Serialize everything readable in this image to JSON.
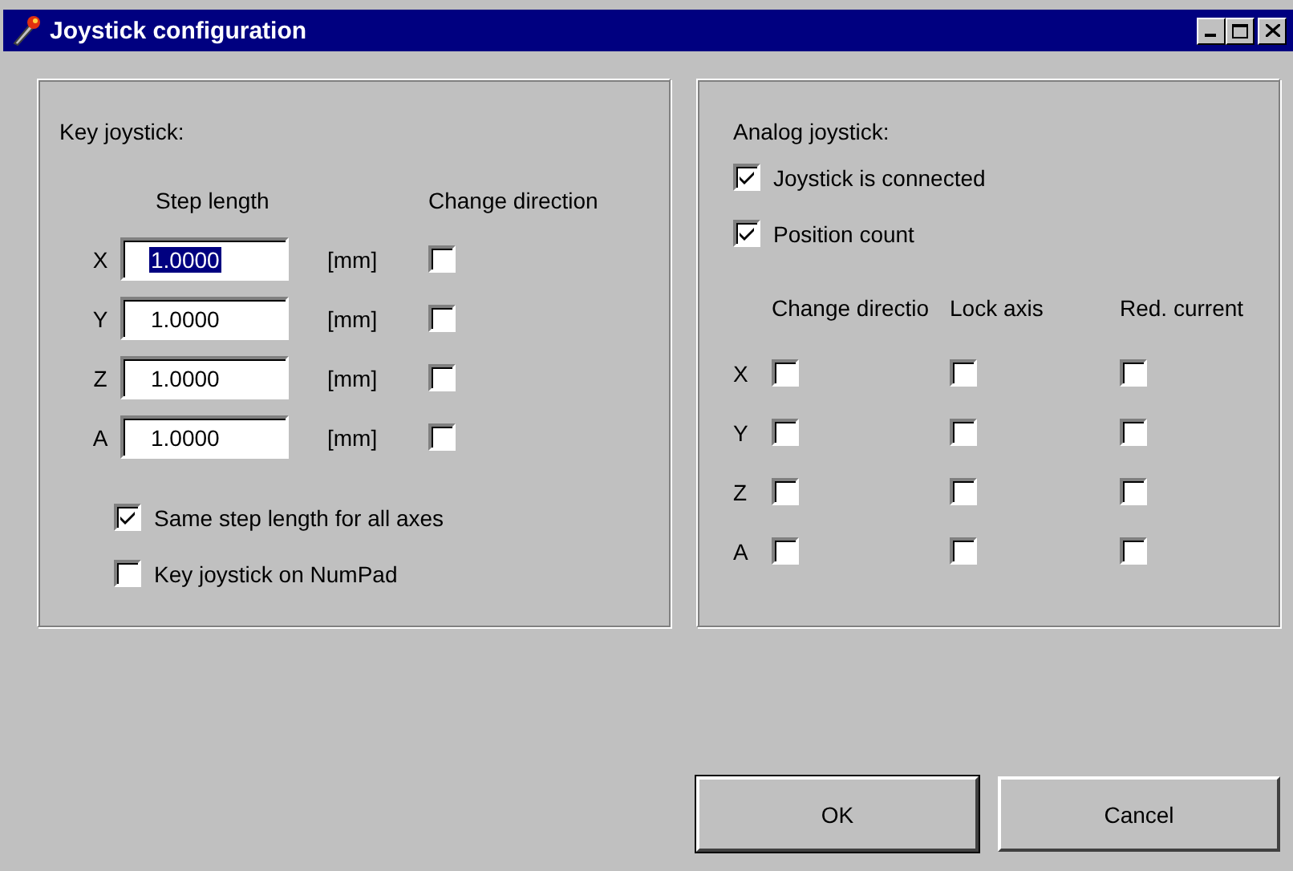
{
  "window": {
    "title": "Joystick configuration"
  },
  "key_joystick": {
    "heading": "Key joystick:",
    "columns": [
      "Step length",
      "Change direction"
    ],
    "axes": [
      {
        "axis": "X",
        "step": "1.0000",
        "unit": "[mm]",
        "focused": true,
        "change_direction": false
      },
      {
        "axis": "Y",
        "step": "1.0000",
        "unit": "[mm]",
        "focused": false,
        "change_direction": false
      },
      {
        "axis": "Z",
        "step": "1.0000",
        "unit": "[mm]",
        "focused": false,
        "change_direction": false
      },
      {
        "axis": "A",
        "step": "1.0000",
        "unit": "[mm]",
        "focused": false,
        "change_direction": false
      }
    ],
    "options": [
      {
        "label": "Same step length for all axes",
        "checked": true
      },
      {
        "label": "Key joystick on NumPad",
        "checked": false
      }
    ]
  },
  "analog_joystick": {
    "heading": "Analog joystick:",
    "options": [
      {
        "label": "Joystick is connected",
        "checked": true
      },
      {
        "label": "Position count",
        "checked": true
      }
    ],
    "columns": [
      "Change directio",
      "Lock axis",
      "Red. current"
    ],
    "axes": [
      {
        "axis": "X",
        "change_direction": false,
        "lock_axis": false,
        "reduced_current": false
      },
      {
        "axis": "Y",
        "change_direction": false,
        "lock_axis": false,
        "reduced_current": false
      },
      {
        "axis": "Z",
        "change_direction": false,
        "lock_axis": false,
        "reduced_current": false
      },
      {
        "axis": "A",
        "change_direction": false,
        "lock_axis": false,
        "reduced_current": false
      }
    ]
  },
  "buttons": [
    {
      "label": "OK",
      "default": true
    },
    {
      "label": "Cancel",
      "default": false
    }
  ]
}
